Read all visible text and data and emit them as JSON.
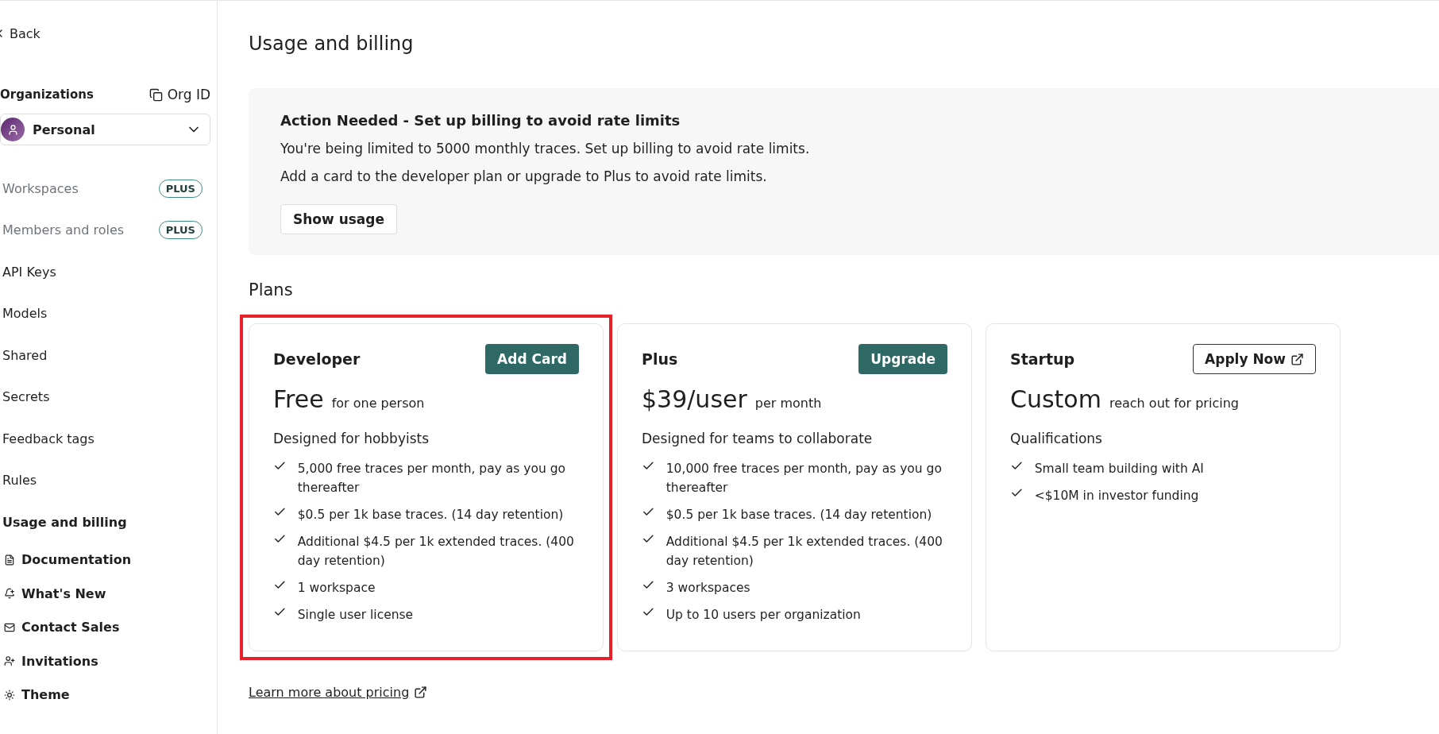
{
  "sidebar": {
    "back": "Back",
    "org_label": "Organizations",
    "org_id": "Org ID",
    "org_select": "Personal",
    "items": [
      {
        "label": "Workspaces",
        "badge": "PLUS",
        "disabled": true,
        "selected": false
      },
      {
        "label": "Members and roles",
        "badge": "PLUS",
        "disabled": true,
        "selected": false
      },
      {
        "label": "API Keys",
        "disabled": false,
        "selected": false
      },
      {
        "label": "Models",
        "disabled": false,
        "selected": false
      },
      {
        "label": "Shared",
        "disabled": false,
        "selected": false
      },
      {
        "label": "Secrets",
        "disabled": false,
        "selected": false
      },
      {
        "label": "Feedback tags",
        "disabled": false,
        "selected": false
      },
      {
        "label": "Rules",
        "disabled": false,
        "selected": false
      },
      {
        "label": "Usage and billing",
        "disabled": false,
        "selected": true
      }
    ],
    "links": [
      {
        "label": "Documentation",
        "kind": "document"
      },
      {
        "label": "What's New",
        "kind": "bell"
      },
      {
        "label": "Contact Sales",
        "kind": "mail"
      },
      {
        "label": "Invitations",
        "kind": "user-plus"
      },
      {
        "label": "Theme",
        "kind": "sun"
      }
    ]
  },
  "page_title": "Usage and billing",
  "alert": {
    "title": "Action Needed - Set up billing to avoid rate limits",
    "lines": [
      "You're being limited to 5000 monthly traces. Set up billing to avoid rate limits.",
      "Add a card to the developer plan or upgrade to Plus to avoid rate limits."
    ],
    "button": "Show usage"
  },
  "plans_heading": "Plans",
  "plans": [
    {
      "name": "Developer",
      "button": {
        "label": "Add Card",
        "kind": "primary"
      },
      "highlighted": true,
      "price": "Free",
      "price_note": "for one person",
      "subtitle": "Designed for hobbyists",
      "features": [
        "5,000 free traces per month, pay as you go thereafter",
        "$0.5 per 1k base traces. (14 day retention)",
        "Additional $4.5 per 1k extended traces. (400 day retention)",
        "1 workspace",
        "Single user license"
      ]
    },
    {
      "name": "Plus",
      "button": {
        "label": "Upgrade",
        "kind": "primary"
      },
      "highlighted": false,
      "price": "$39/user",
      "price_note": "per month",
      "subtitle": "Designed for teams to collaborate",
      "features": [
        "10,000 free traces per month, pay as you go thereafter",
        "$0.5 per 1k base traces. (14 day retention)",
        "Additional $4.5 per 1k extended traces. (400 day retention)",
        "3 workspaces",
        "Up to 10 users per organization"
      ]
    },
    {
      "name": "Startup",
      "button": {
        "label": "Apply Now",
        "kind": "external"
      },
      "highlighted": false,
      "price": "Custom",
      "price_note": "reach out for pricing",
      "subtitle": "Qualifications",
      "features": [
        "Small team building with AI",
        "<$10M in investor funding"
      ]
    }
  ],
  "pricing_link": "Learn more about pricing"
}
